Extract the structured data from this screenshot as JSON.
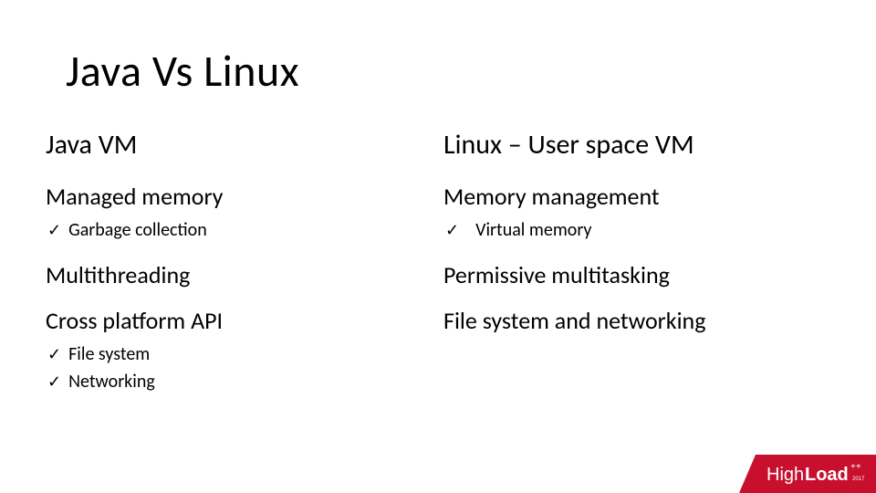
{
  "title": "Java Vs Linux",
  "left": {
    "heading": "Java VM",
    "items": [
      {
        "label": "Managed memory",
        "subs": [
          "Garbage collection"
        ]
      },
      {
        "label": "Multithreading",
        "subs": []
      },
      {
        "label": "Cross platform API",
        "subs": [
          "File system",
          "Networking"
        ]
      }
    ]
  },
  "right": {
    "heading": "Linux – User space VM",
    "items": [
      {
        "label": "Memory management",
        "subs": [
          "Virtual memory"
        ]
      },
      {
        "label": "Permissive multitasking",
        "subs": []
      },
      {
        "label": "File system and networking",
        "subs": []
      }
    ]
  },
  "logo": {
    "thin": "High",
    "bold": "Load",
    "year": "2017",
    "bg": "#c8102e"
  }
}
